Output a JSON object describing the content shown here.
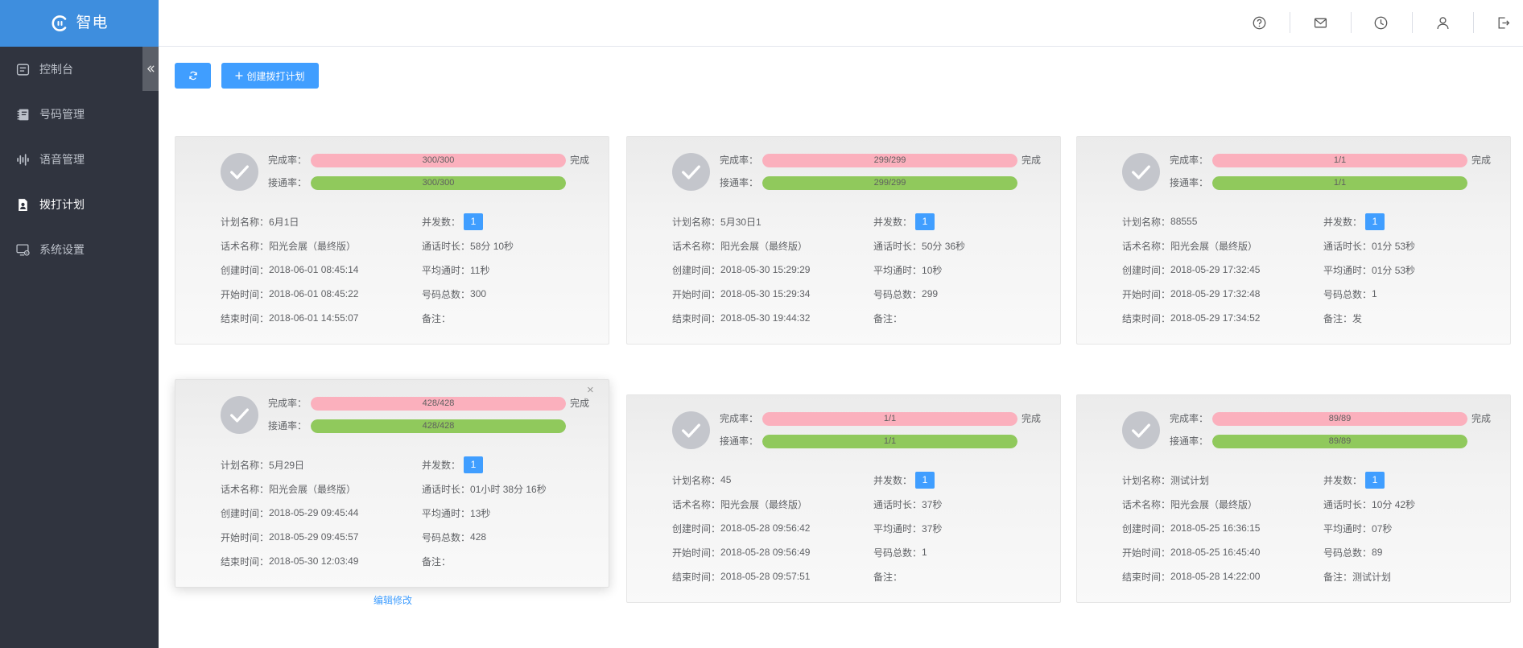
{
  "app": {
    "logo_text": "智电"
  },
  "sidebar": {
    "items": [
      {
        "label": "控制台",
        "icon": "dashboard-icon"
      },
      {
        "label": "号码管理",
        "icon": "number-book-icon"
      },
      {
        "label": "语音管理",
        "icon": "waveform-icon"
      },
      {
        "label": "拨打计划",
        "icon": "call-plan-icon",
        "active": true
      },
      {
        "label": "系统设置",
        "icon": "system-settings-icon"
      }
    ],
    "collapse_icon": "double-chevron-left-icon"
  },
  "header": {
    "icons": [
      "help-icon",
      "mail-icon",
      "clock-icon",
      "user-icon",
      "logout-icon"
    ]
  },
  "toolbar": {
    "refresh_icon": "refresh-icon",
    "create_icon": "plus-icon",
    "create_label": "创建拨打计划"
  },
  "labels": {
    "completion": "完成率：",
    "connect": "接通率：",
    "plan_name": "计划名称：",
    "concurrency": "并发数：",
    "script_name": "话术名称：",
    "call_duration": "通话时长：",
    "created": "创建时间：",
    "avg_duration": "平均通时：",
    "start": "开始时间：",
    "total_numbers": "号码总数：",
    "end": "结束时间：",
    "note": "备注："
  },
  "card_actions": {
    "close_glyph": "×",
    "edit_label": "编辑修改"
  },
  "colors": {
    "brand": "#409eff",
    "logo_bg": "#3e8ede",
    "sidebar_bg": "#30343f",
    "completion_bar": "#fbb0bd",
    "connect_bar": "#90c95c",
    "check_circle": "#c4c6cc"
  },
  "plans": [
    {
      "completion": "300/300",
      "completion_fill": 1,
      "connect": "300/300",
      "connect_fill": 1,
      "status": "完成",
      "name": "6月1日",
      "concurrency": "1",
      "script": "阳光会展（最终版）",
      "duration": "58分 10秒",
      "created": "2018-06-01 08:45:14",
      "avg_duration": "11秒",
      "start": "2018-06-01 08:45:22",
      "total": "300",
      "end": "2018-06-01 14:55:07",
      "note": ""
    },
    {
      "completion": "299/299",
      "completion_fill": 1,
      "connect": "299/299",
      "connect_fill": 1,
      "status": "完成",
      "name": "5月30日1",
      "concurrency": "1",
      "script": "阳光会展（最终版）",
      "duration": "50分 36秒",
      "created": "2018-05-30 15:29:29",
      "avg_duration": "10秒",
      "start": "2018-05-30 15:29:34",
      "total": "299",
      "end": "2018-05-30 19:44:32",
      "note": ""
    },
    {
      "completion": "1/1",
      "completion_fill": 1,
      "connect": "1/1",
      "connect_fill": 1,
      "status": "完成",
      "name": "88555",
      "concurrency": "1",
      "script": "阳光会展（最终版）",
      "duration": "01分 53秒",
      "created": "2018-05-29 17:32:45",
      "avg_duration": "01分 53秒",
      "start": "2018-05-29 17:32:48",
      "total": "1",
      "end": "2018-05-29 17:34:52",
      "note": "发"
    },
    {
      "completion": "428/428",
      "completion_fill": 1,
      "connect": "428/428",
      "connect_fill": 1,
      "status": "完成",
      "name": "5月29日",
      "concurrency": "1",
      "script": "阳光会展（最终版）",
      "duration": "01小时 38分 16秒",
      "created": "2018-05-29 09:45:44",
      "avg_duration": "13秒",
      "start": "2018-05-29 09:45:57",
      "total": "428",
      "end": "2018-05-30 12:03:49",
      "note": "",
      "hovered": true
    },
    {
      "completion": "1/1",
      "completion_fill": 1,
      "connect": "1/1",
      "connect_fill": 1,
      "status": "完成",
      "name": "45",
      "concurrency": "1",
      "script": "阳光会展（最终版）",
      "duration": "37秒",
      "created": "2018-05-28 09:56:42",
      "avg_duration": "37秒",
      "start": "2018-05-28 09:56:49",
      "total": "1",
      "end": "2018-05-28 09:57:51",
      "note": ""
    },
    {
      "completion": "89/89",
      "completion_fill": 1,
      "connect": "89/89",
      "connect_fill": 1,
      "status": "完成",
      "name": "测试计划",
      "concurrency": "1",
      "script": "阳光会展（最终版）",
      "duration": "10分 42秒",
      "created": "2018-05-25 16:36:15",
      "avg_duration": "07秒",
      "start": "2018-05-25 16:45:40",
      "total": "89",
      "end": "2018-05-28 14:22:00",
      "note": "测试计划"
    }
  ]
}
